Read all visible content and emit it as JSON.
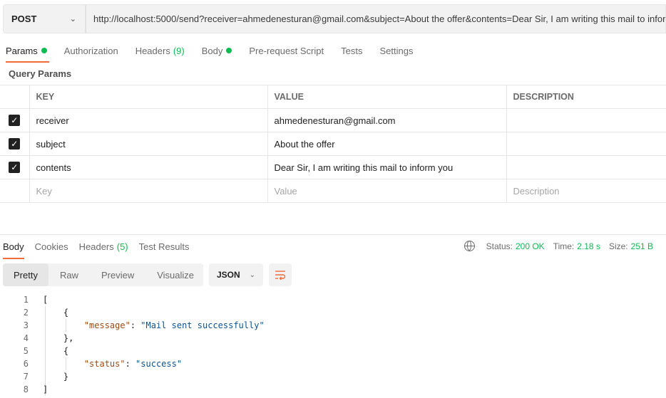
{
  "request": {
    "method": "POST",
    "url": "http://localhost:5000/send?receiver=ahmedenesturan@gmail.com&subject=About the offer&contents=Dear Sir, I am writing this mail to infor"
  },
  "request_tabs": [
    {
      "label": "Params",
      "dot": true,
      "active": true
    },
    {
      "label": "Authorization"
    },
    {
      "label": "Headers",
      "count": "(9)"
    },
    {
      "label": "Body",
      "dot": true
    },
    {
      "label": "Pre-request Script"
    },
    {
      "label": "Tests"
    },
    {
      "label": "Settings"
    }
  ],
  "params": {
    "title": "Query Params",
    "headers": {
      "key": "KEY",
      "value": "VALUE",
      "description": "DESCRIPTION"
    },
    "rows": [
      {
        "checked": true,
        "key": "receiver",
        "value": "ahmedenesturan@gmail.com",
        "description": ""
      },
      {
        "checked": true,
        "key": "subject",
        "value": "About the offer",
        "description": ""
      },
      {
        "checked": true,
        "key": "contents",
        "value": "Dear Sir, I am writing this mail to inform you",
        "description": ""
      }
    ],
    "placeholders": {
      "key": "Key",
      "value": "Value",
      "description": "Description"
    }
  },
  "response_tabs": [
    {
      "label": "Body",
      "active": true
    },
    {
      "label": "Cookies"
    },
    {
      "label": "Headers",
      "count": "(5)"
    },
    {
      "label": "Test Results"
    }
  ],
  "status": {
    "status_label": "Status:",
    "status_value": "200 OK",
    "time_label": "Time:",
    "time_value": "2.18 s",
    "size_label": "Size:",
    "size_value": "251 B"
  },
  "view_modes": [
    "Pretty",
    "Raw",
    "Preview",
    "Visualize"
  ],
  "format": "JSON",
  "code_lines": [
    {
      "n": "1",
      "text": "["
    },
    {
      "n": "2",
      "text": "    {"
    },
    {
      "n": "3",
      "text": "        \"message\": \"Mail sent successfully\""
    },
    {
      "n": "4",
      "text": "    },"
    },
    {
      "n": "5",
      "text": "    {"
    },
    {
      "n": "6",
      "text": "        \"status\": \"success\""
    },
    {
      "n": "7",
      "text": "    }"
    },
    {
      "n": "8",
      "text": "]"
    }
  ],
  "colors": {
    "accent": "#f26b3a",
    "success": "#0cbb52"
  }
}
